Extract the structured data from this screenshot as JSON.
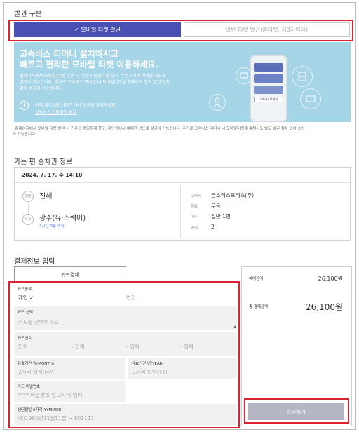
{
  "issuance": {
    "title": "발권 구분",
    "mobile_label": "✓ 모바일 티켓 발권",
    "paper_label": "일반 티켓 발권(홈티켓, 제3자이체)"
  },
  "banner": {
    "headline1": "고속버스 티머니 설치하시고",
    "headline2": "빠르고 편리한 모바일 티켓 이용하세요.",
    "body1": "홈페이지에서 모바일 티켓 발권 시 기존과 동일하게 창구, 무인기에서 예매한 카드로",
    "body2": "발권이 가능합니다. 추가로 고속버스 모바일 내 모바일티켓을 통해서도 별도 발권 절차",
    "body3": "없이 승차가 가능합니다.",
    "note": "아직 앱이 없으시다면 아래 버튼을 클릭하세요.",
    "install_link": "고속버스 모바일앱 설치",
    "app_name": "고속버스모바일"
  },
  "description": {
    "line1": "· 홈페이지에서 모바일 티켓 발권 시 기존과 동일하게 창구, 무인기에서 예매한 카드로 발권이 가능합니다. 추가로 고속버스 티머니 내 모바일티켓을 통해서도 별도 발권 절차 없이 승차",
    "line2": "가 가능합니다."
  },
  "trip": {
    "section_title": "가는 편 승차권 정보",
    "datetime": "2024. 7. 17. 수 14:10",
    "depart_badge": "출발",
    "depart_name": "진해",
    "arrive_badge": "도착",
    "arrive_name": "광주(유·스퀘어)",
    "duration": "3시간 0분 소요",
    "labels": {
      "company": "고속사",
      "grade": "등급",
      "count": "매수",
      "seat": "좌석"
    },
    "values": {
      "company": "금호익스프레스(주)",
      "grade": "우등",
      "count": "일반 1명",
      "seat": "2"
    }
  },
  "payment": {
    "section_title": "결제정보 입력",
    "tab_card": "카드결제",
    "card_type_label": "카드종류",
    "card_type_personal": "개인 ✓",
    "card_type_corporate": "법인",
    "card_select_label": "카드 선택",
    "card_select_placeholder": "카드를 선택하세요",
    "card_number_label": "카드번호",
    "card_number_placeholders": [
      "입력",
      "- 입력",
      "- 입력",
      "- 입력"
    ],
    "expiry_month_label": "유효기간 월(MONTH)",
    "expiry_month_placeholder": "2자리 입력(MM)",
    "expiry_year_label": "유효기간 년(YEAR)",
    "expiry_year_placeholder": "2자리 입력(YY)",
    "password_label": "카드 비밀번호",
    "password_placeholder": "**** 비밀번호 앞 2자리 입력",
    "birth_label": "생년월일 6자리(YYMMDD)",
    "birth_placeholder": "예)1980년11월11일 → 801111"
  },
  "summary": {
    "booking_amount_label": "예매금액",
    "booking_amount": "26,100원",
    "total_label": "총 결제금액",
    "total_amount": "26,100원",
    "pay_button": "결제하기"
  },
  "colors": {
    "accent": "#4a4fb3",
    "highlight": "#d9232e",
    "banner": "#a6d5e8",
    "pay_disabled": "#b4b7c3"
  }
}
